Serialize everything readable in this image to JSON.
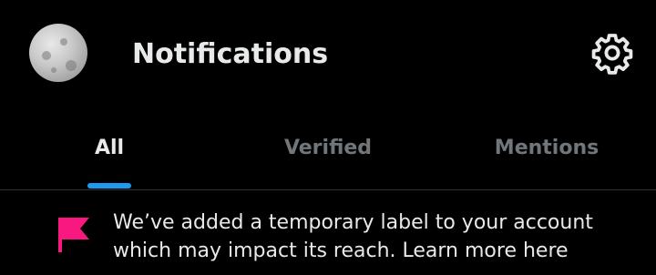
{
  "header": {
    "title": "Notifications",
    "avatar_icon": "moon-avatar",
    "settings_icon": "gear-icon"
  },
  "tabs": [
    {
      "label": "All",
      "active": true
    },
    {
      "label": "Verified",
      "active": false
    },
    {
      "label": "Mentions",
      "active": false
    }
  ],
  "notice": {
    "icon": "flag-icon",
    "icon_color": "#f91880",
    "text": "We’ve added a temporary label to your account which may impact its reach. Learn more here"
  },
  "colors": {
    "background": "#000000",
    "primary_text": "#e7e9ea",
    "secondary_text": "#71767b",
    "accent": "#1d9bf0",
    "divider": "#2f3336"
  }
}
